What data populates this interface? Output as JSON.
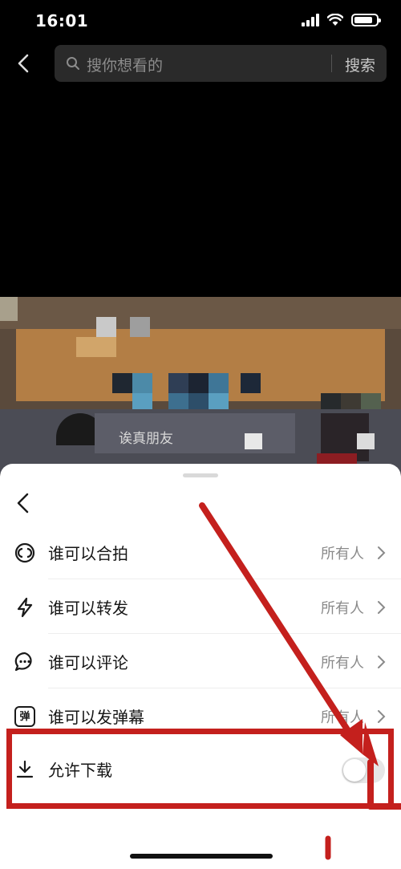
{
  "status_bar": {
    "time": "16:01"
  },
  "search": {
    "placeholder": "搜你想看的",
    "button": "搜索"
  },
  "video": {
    "caption": "诶真朋友"
  },
  "settings": {
    "rows": [
      {
        "label": "谁可以合拍",
        "value": "所有人",
        "icon": "duet-icon"
      },
      {
        "label": "谁可以转发",
        "value": "所有人",
        "icon": "lightning-icon"
      },
      {
        "label": "谁可以评论",
        "value": "所有人",
        "icon": "comment-icon"
      },
      {
        "label": "谁可以发弹幕",
        "value": "所有人",
        "icon": "danmaku-icon",
        "icon_text": "弹"
      }
    ],
    "download": {
      "label": "允许下载",
      "enabled": false,
      "icon": "download-icon"
    }
  },
  "colors": {
    "highlight": "#c4201d",
    "sheet_bg": "#ffffff",
    "page_bg": "#000000"
  }
}
